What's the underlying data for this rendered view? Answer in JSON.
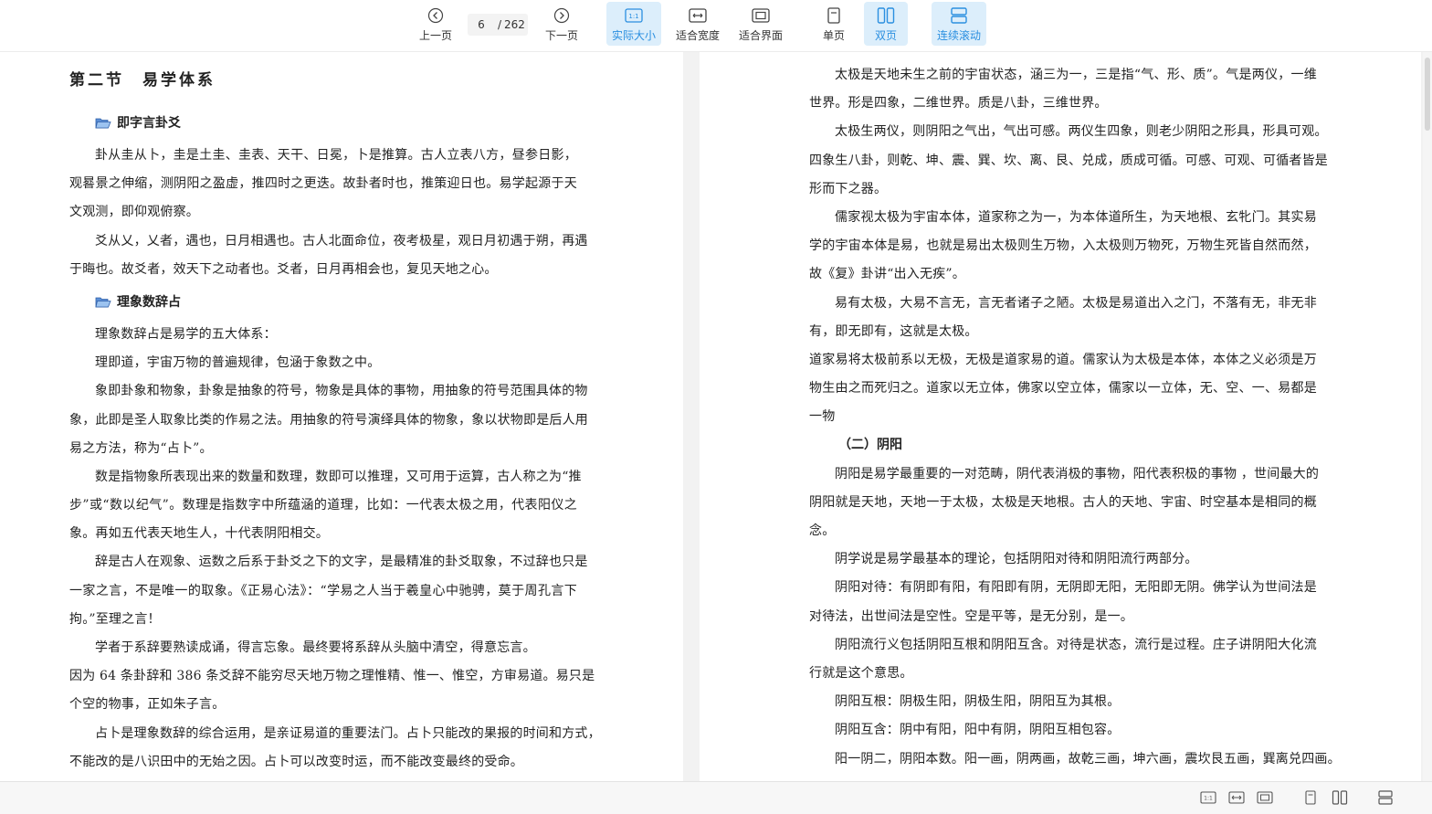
{
  "toolbar": {
    "prev_label": "上一页",
    "next_label": "下一页",
    "current_page": "6",
    "separator": "/",
    "total_pages": "262",
    "actual_size_label": "实际大小",
    "fit_width_label": "适合宽度",
    "fit_screen_label": "适合界面",
    "single_page_label": "单页",
    "double_page_label": "双页",
    "continuous_label": "连续滚动",
    "accent": "#2b8fe0",
    "active_bg": "#dceefb"
  },
  "left_page": {
    "section_title": "第二节　易学体系",
    "sub1": "即字言卦爻",
    "p1": [
      "卦从圭从卜，圭是土圭、圭表、天干、日冕，卜是推算。古人立表八方，昼参日影，",
      "观晷景之伸缩，测阴阳之盈虚，推四时之更迭。故卦者时也，推策迎日也。易学起源于天",
      "文观测，即仰观俯察。"
    ],
    "p2": [
      "爻从乂，乂者，遇也，日月相遇也。古人北面命位，夜考极星，观日月初遇于朔，再遇",
      "于晦也。故爻者，效天下之动者也。爻者，日月再相会也，复见天地之心。"
    ],
    "sub2": "理象数辞占",
    "p3": [
      "理象数辞占是易学的五大体系："
    ],
    "p4": [
      "理即道，宇宙万物的普遍规律，包涵于象数之中。"
    ],
    "p5": [
      "象即卦象和物象，卦象是抽象的符号，物象是具体的事物，用抽象的符号范围具体的物",
      "象，此即是圣人取象比类的作易之法。用抽象的符号演绎具体的物象，象以状物即是后人用",
      "易之方法，称为“占卜”。"
    ],
    "p6": [
      "数是指物象所表现出来的数量和数理，数即可以推理，又可用于运算，古人称之为“推",
      "步”或“数以纪气”。数理是指数字中所蕴涵的道理，比如：一代表太极之用，代表阳仪之",
      "象。再如五代表天地生人，十代表阴阳相交。"
    ],
    "p7": [
      "辞是古人在观象、运数之后系于卦爻之下的文字，是最精准的卦爻取象，不过辞也只是",
      "一家之言，不是唯一的取象。《正易心法》：“学易之人当于羲皇心中驰骋，莫于周孔言下",
      "拘。”至理之言！"
    ],
    "p8": [
      "学者于系辞要熟读成诵，得言忘象。最终要将系辞从头脑中清空，得意忘言。"
    ],
    "p9": [
      "因为 64 条卦辞和 386 条爻辞不能穷尽天地万物之理惟精、惟一、惟空，方审易道。易只是",
      "个空的物事，正如朱子言。"
    ],
    "p10": [
      "占卜是理象数辞的综合运用，是亲证易道的重要法门。占卜只能改的果报的时间和方式，",
      "不能改的是八识田中的无始之因。占卜可以改变时运，而不能改变最终的受命。"
    ]
  },
  "right_page": {
    "r1": [
      "太极是天地未生之前的宇宙状态，涵三为一，三是指“气、形、质”。气是两仪，一维",
      "世界。形是四象，二维世界。质是八卦，三维世界。"
    ],
    "r2": [
      "太极生两仪，则阴阳之气出，气出可感。两仪生四象，则老少阴阳之形具，形具可观。",
      "四象生八卦，则乾、坤、震、巽、坎、离、艮、兑成，质成可循。可感、可观、可循者皆是",
      "形而下之器。"
    ],
    "r3": [
      "儒家视太极为宇宙本体，道家称之为一，为本体道所生，为天地根、玄牝门。其实易",
      "学的宇宙本体是易，也就是易出太极则生万物，入太极则万物死，万物生死皆自然而然，",
      "故《复》卦讲“出入无疾”。"
    ],
    "r4": [
      "易有太极，大易不言无，言无者诸子之陋。太极是易道出入之门，不落有无，非无非",
      "有，即无即有，这就是太极。"
    ],
    "r5": [
      "道家易将太极前系以无极，无极是道家易的道。儒家认为太极是本体，本体之义必须是万",
      "物生由之而死归之。道家以无立体，佛家以空立体，儒家以一立体，无、空、一、易都是",
      "一物"
    ],
    "h_yinyang": "（二）阴阳",
    "r6": [
      "阴阳是易学最重要的一对范畴，阴代表消极的事物，阳代表积极的事物 ，世间最大的",
      "阴阳就是天地，天地一于太极，太极是天地根。古人的天地、宇宙、时空基本是相同的概",
      "念。"
    ],
    "r7": [
      "阴学说是易学最基本的理论，包括阴阳对待和阴阳流行两部分。"
    ],
    "r8": [
      "阴阳对待：有阴即有阳，有阳即有阴，无阴即无阳，无阳即无阴。佛学认为世间法是",
      "对待法，出世间法是空性。空是平等，是无分别，是一。"
    ],
    "r9": [
      "阴阳流行义包括阴阳互根和阴阳互含。对待是状态，流行是过程。庄子讲阴阳大化流",
      "行就是这个意思。"
    ],
    "r10": [
      "阴阳互根：阴极生阳，阴极生阳，阴阳互为其根。"
    ],
    "r11": [
      "阴阳互含：阴中有阳，阳中有阴，阴阳互相包容。"
    ],
    "r12": [
      "阳一阴二，阴阳本数。阳一画，阴两画，故乾三画，坤六画，震坎艮五画，巽离兑四画。"
    ]
  }
}
